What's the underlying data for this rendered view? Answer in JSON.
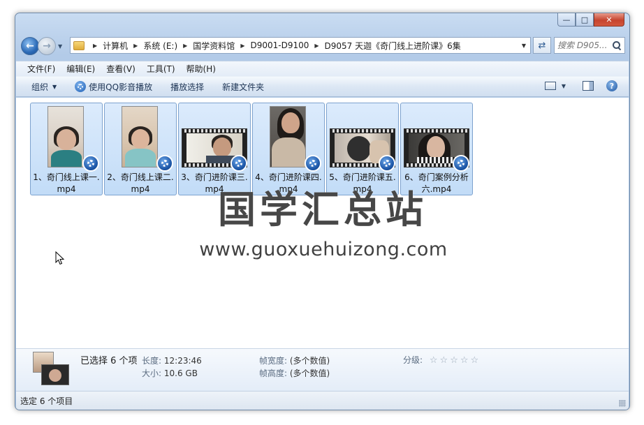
{
  "nav": {
    "breadcrumbs": [
      "计算机",
      "系统 (E:)",
      "国学资料馆",
      "D9001-D9100",
      "D9057 天迦《奇门线上进阶课》6集"
    ],
    "search_placeholder": "搜索 D905..."
  },
  "menu": [
    "文件(F)",
    "编辑(E)",
    "查看(V)",
    "工具(T)",
    "帮助(H)"
  ],
  "toolbar": {
    "organize": "组织",
    "qq_play": "使用QQ影音播放",
    "play_selection": "播放选择",
    "new_folder": "新建文件夹"
  },
  "files": [
    {
      "name": "1、奇门线上课一.mp4",
      "thumb": "portrait"
    },
    {
      "name": "2、奇门线上课二.mp4",
      "thumb": "portrait"
    },
    {
      "name": "3、奇门进阶课三.mp4",
      "thumb": "film"
    },
    {
      "name": "4、奇门进阶课四.mp4",
      "thumb": "portrait"
    },
    {
      "name": "5、奇门进阶课五.mp4",
      "thumb": "film"
    },
    {
      "name": "6、奇门案例分析六.mp4",
      "thumb": "film"
    }
  ],
  "watermark": {
    "cn": "国学汇总站",
    "url": "www.guoxuehuizong.com"
  },
  "details": {
    "selected": "已选择 6 个项",
    "length_label": "长度:",
    "length_value": "12:23:46",
    "size_label": "大小:",
    "size_value": "10.6 GB",
    "frame_width_label": "帧宽度:",
    "frame_width_value": "(多个数值)",
    "frame_height_label": "帧高度:",
    "frame_height_value": "(多个数值)",
    "rating_label": "分级:",
    "rating_stars": 0
  },
  "status": {
    "text": "选定 6 个项目"
  },
  "colors": {
    "accent": "#2a69b6",
    "selection": "#c2dcf7",
    "close": "#c6452f"
  }
}
